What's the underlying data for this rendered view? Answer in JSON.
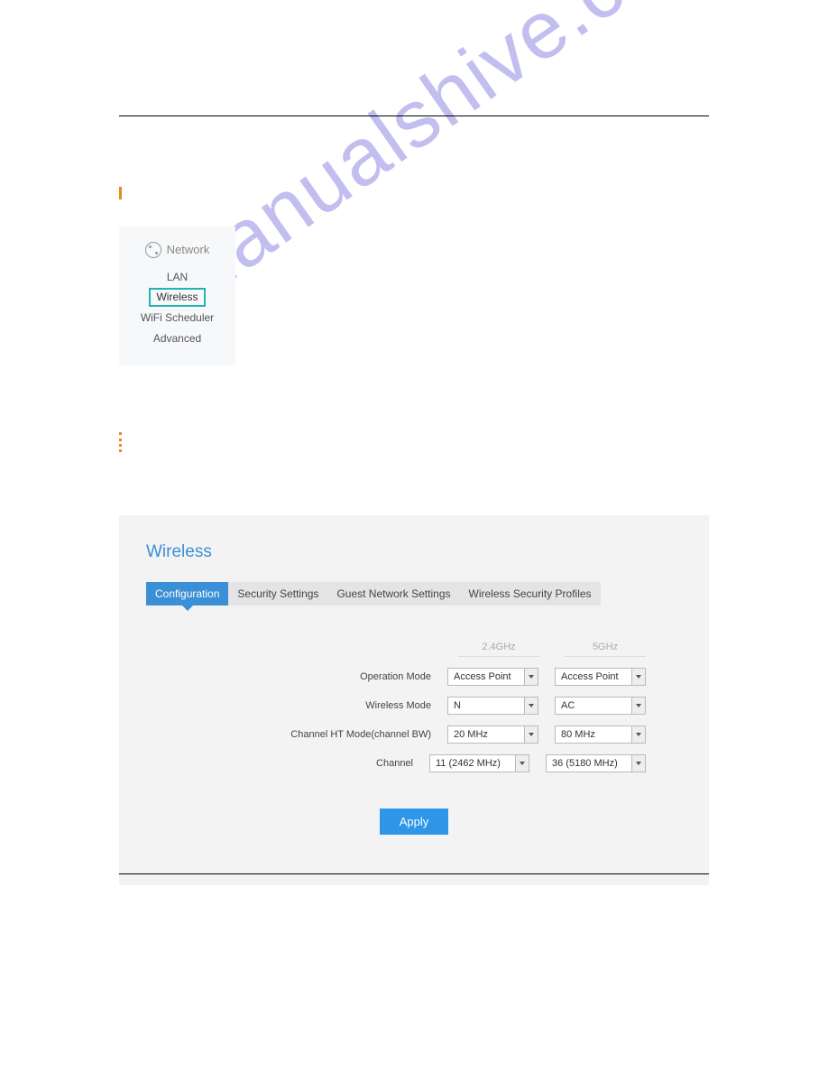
{
  "watermark_text": "manualshive.com",
  "nav": {
    "title": "Network",
    "items": [
      "LAN",
      "Wireless",
      "WiFi Scheduler",
      "Advanced"
    ],
    "highlighted_index": 1
  },
  "wireless": {
    "title": "Wireless",
    "tabs": [
      "Configuration",
      "Security Settings",
      "Guest Network Settings",
      "Wireless Security Profiles"
    ],
    "active_tab_index": 0,
    "columns": [
      "2.4GHz",
      "5GHz"
    ],
    "rows": [
      {
        "label": "Operation Mode",
        "col24": "Access Point",
        "col5": "Access Point",
        "w": "w1"
      },
      {
        "label": "Wireless Mode",
        "col24": "N",
        "col5": "AC",
        "w": "w1"
      },
      {
        "label": "Channel HT Mode(channel BW)",
        "col24": "20 MHz",
        "col5": "80 MHz",
        "w": "w2"
      },
      {
        "label": "Channel",
        "col24": "11 (2462 MHz)",
        "col5": "36 (5180 MHz)",
        "w": "wch"
      }
    ],
    "apply_label": "Apply"
  }
}
